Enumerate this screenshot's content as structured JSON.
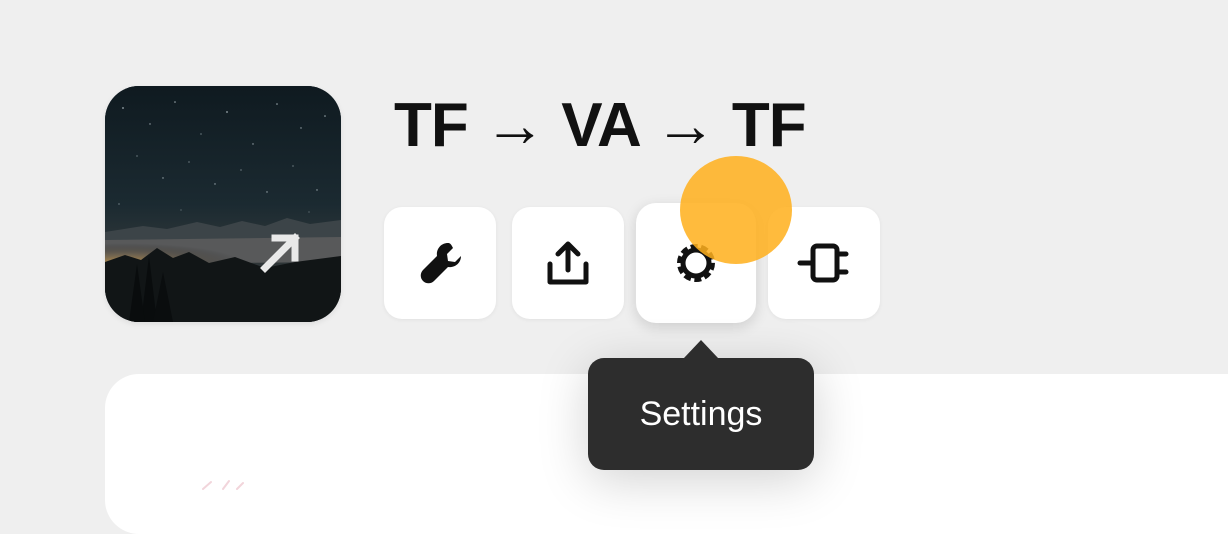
{
  "workflow": {
    "title": "TF → VA → TF",
    "thumbnail_icon": "open-external-arrow-icon"
  },
  "toolbar": {
    "buttons": [
      {
        "icon": "wrench-icon",
        "name": "tools"
      },
      {
        "icon": "share-upload-icon",
        "name": "share"
      },
      {
        "icon": "gear-icon",
        "name": "settings",
        "active": true
      },
      {
        "icon": "plugin-connector-icon",
        "name": "integrations"
      }
    ]
  },
  "tooltip": {
    "text": "Settings"
  },
  "colors": {
    "background": "#efefef",
    "card": "#ffffff",
    "tooltip": "#2d2d2d",
    "cursor_highlight": "#ffb01d",
    "icon": "#111111"
  }
}
